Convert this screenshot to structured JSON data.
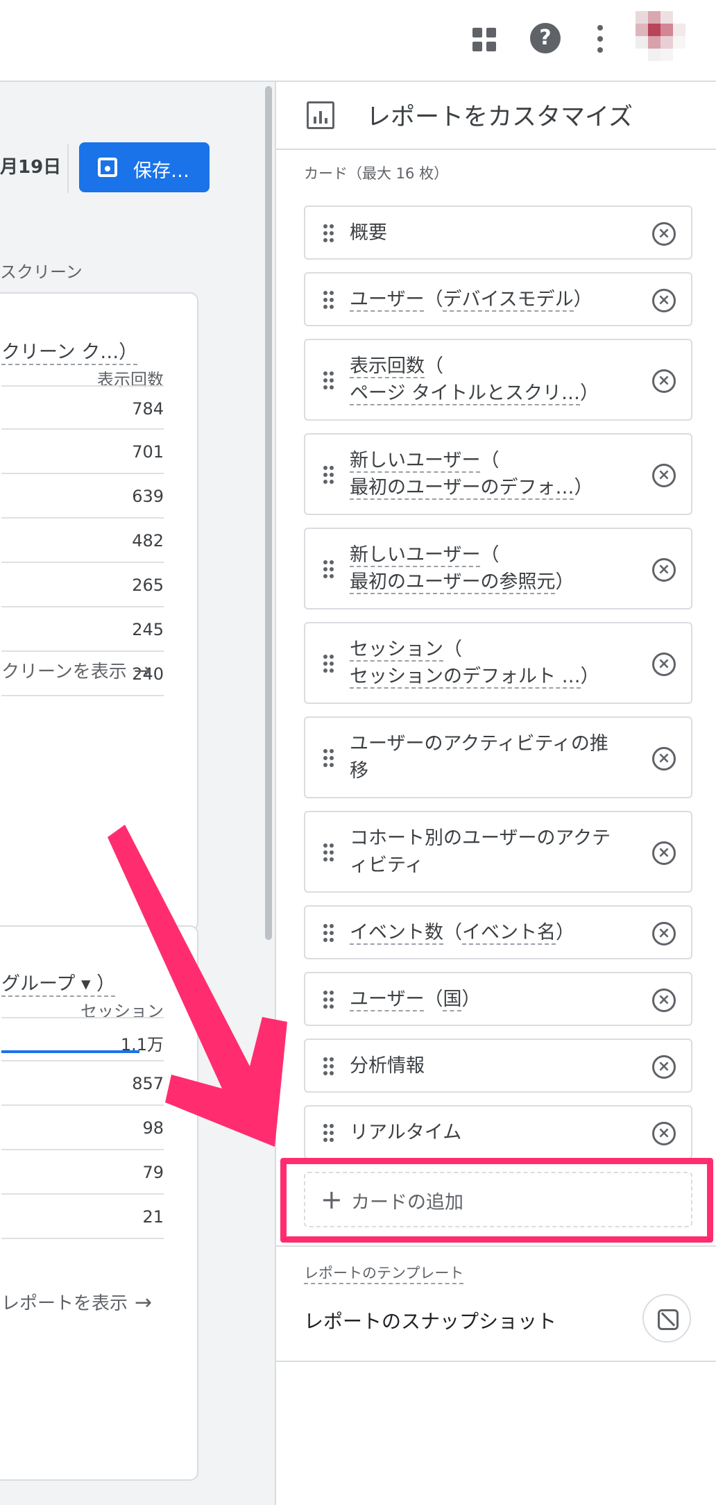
{
  "topbar": {
    "help_glyph": "?"
  },
  "report": {
    "date_fragment": "月19日",
    "save_label": "保存…",
    "section_fragment": "スクリーン",
    "card1": {
      "title_fragment": "クリーン ク…）",
      "column_header": "表示回数",
      "values": [
        "784",
        "701",
        "639",
        "482",
        "265",
        "245",
        "240"
      ],
      "link_fragment": "クリーンを表示"
    },
    "card2": {
      "title_fragment": "グループ ▾ ）",
      "column_header": "セッション",
      "values": [
        "1.1万",
        "857",
        "98",
        "79",
        "21"
      ],
      "first_row_share": 0.85,
      "link_fragment": "レポートを表示"
    },
    "arrow_glyph": "→"
  },
  "panel": {
    "title": "レポートをカスタマイズ",
    "cards_label": "カード（最大 16 枚）",
    "cards": [
      {
        "lines": [
          [
            {
              "t": "概要",
              "u": false
            }
          ]
        ]
      },
      {
        "lines": [
          [
            {
              "t": "ユーザー",
              "u": true
            },
            {
              "t": "（",
              "u": false
            },
            {
              "t": "デバイスモデル",
              "u": true
            },
            {
              "t": "）",
              "u": false
            }
          ]
        ]
      },
      {
        "lines": [
          [
            {
              "t": "表示回数",
              "u": true
            },
            {
              "t": "（",
              "u": false
            }
          ],
          [
            {
              "t": "ページ タイトルとスクリ…",
              "u": true
            },
            {
              "t": "）",
              "u": false
            }
          ]
        ]
      },
      {
        "lines": [
          [
            {
              "t": "新しいユーザー",
              "u": true
            },
            {
              "t": "（",
              "u": false
            }
          ],
          [
            {
              "t": "最初のユーザーのデフォ…",
              "u": true
            },
            {
              "t": "）",
              "u": false
            }
          ]
        ]
      },
      {
        "lines": [
          [
            {
              "t": "新しいユーザー",
              "u": true
            },
            {
              "t": "（",
              "u": false
            }
          ],
          [
            {
              "t": "最初のユーザーの参照元",
              "u": true
            },
            {
              "t": "）",
              "u": false
            }
          ]
        ]
      },
      {
        "lines": [
          [
            {
              "t": "セッション",
              "u": true
            },
            {
              "t": "（",
              "u": false
            }
          ],
          [
            {
              "t": "セッションのデフォルト …",
              "u": true
            },
            {
              "t": "）",
              "u": false
            }
          ]
        ]
      },
      {
        "lines": [
          [
            {
              "t": "ユーザーのアクティビティの推",
              "u": false
            }
          ],
          [
            {
              "t": "移",
              "u": false
            }
          ]
        ]
      },
      {
        "lines": [
          [
            {
              "t": "コホート別のユーザーのアクテ",
              "u": false
            }
          ],
          [
            {
              "t": "ィビティ",
              "u": false
            }
          ]
        ]
      },
      {
        "lines": [
          [
            {
              "t": "イベント数",
              "u": true
            },
            {
              "t": "（",
              "u": false
            },
            {
              "t": "イベント名",
              "u": true
            },
            {
              "t": "）",
              "u": false
            }
          ]
        ]
      },
      {
        "lines": [
          [
            {
              "t": "ユーザー",
              "u": true
            },
            {
              "t": "（",
              "u": false
            },
            {
              "t": "国",
              "u": true
            },
            {
              "t": "）",
              "u": false
            }
          ]
        ]
      },
      {
        "lines": [
          [
            {
              "t": "分析情報",
              "u": false
            }
          ]
        ]
      },
      {
        "lines": [
          [
            {
              "t": "リアルタイム",
              "u": false
            }
          ]
        ]
      }
    ],
    "add_card_label": "カードの追加",
    "template_label": "レポートのテンプレート",
    "snapshot_label": "レポートのスナップショット"
  },
  "colors": {
    "accent": "#1a73e8",
    "annotation": "#ff2d6f"
  },
  "icons": [
    "apps-icon",
    "help-icon",
    "more-vert-icon",
    "avatar",
    "save-icon",
    "edit-report-icon",
    "drag-handle-icon",
    "remove-circle-icon",
    "plus-icon",
    "link-off-icon",
    "arrow-right-icon"
  ]
}
